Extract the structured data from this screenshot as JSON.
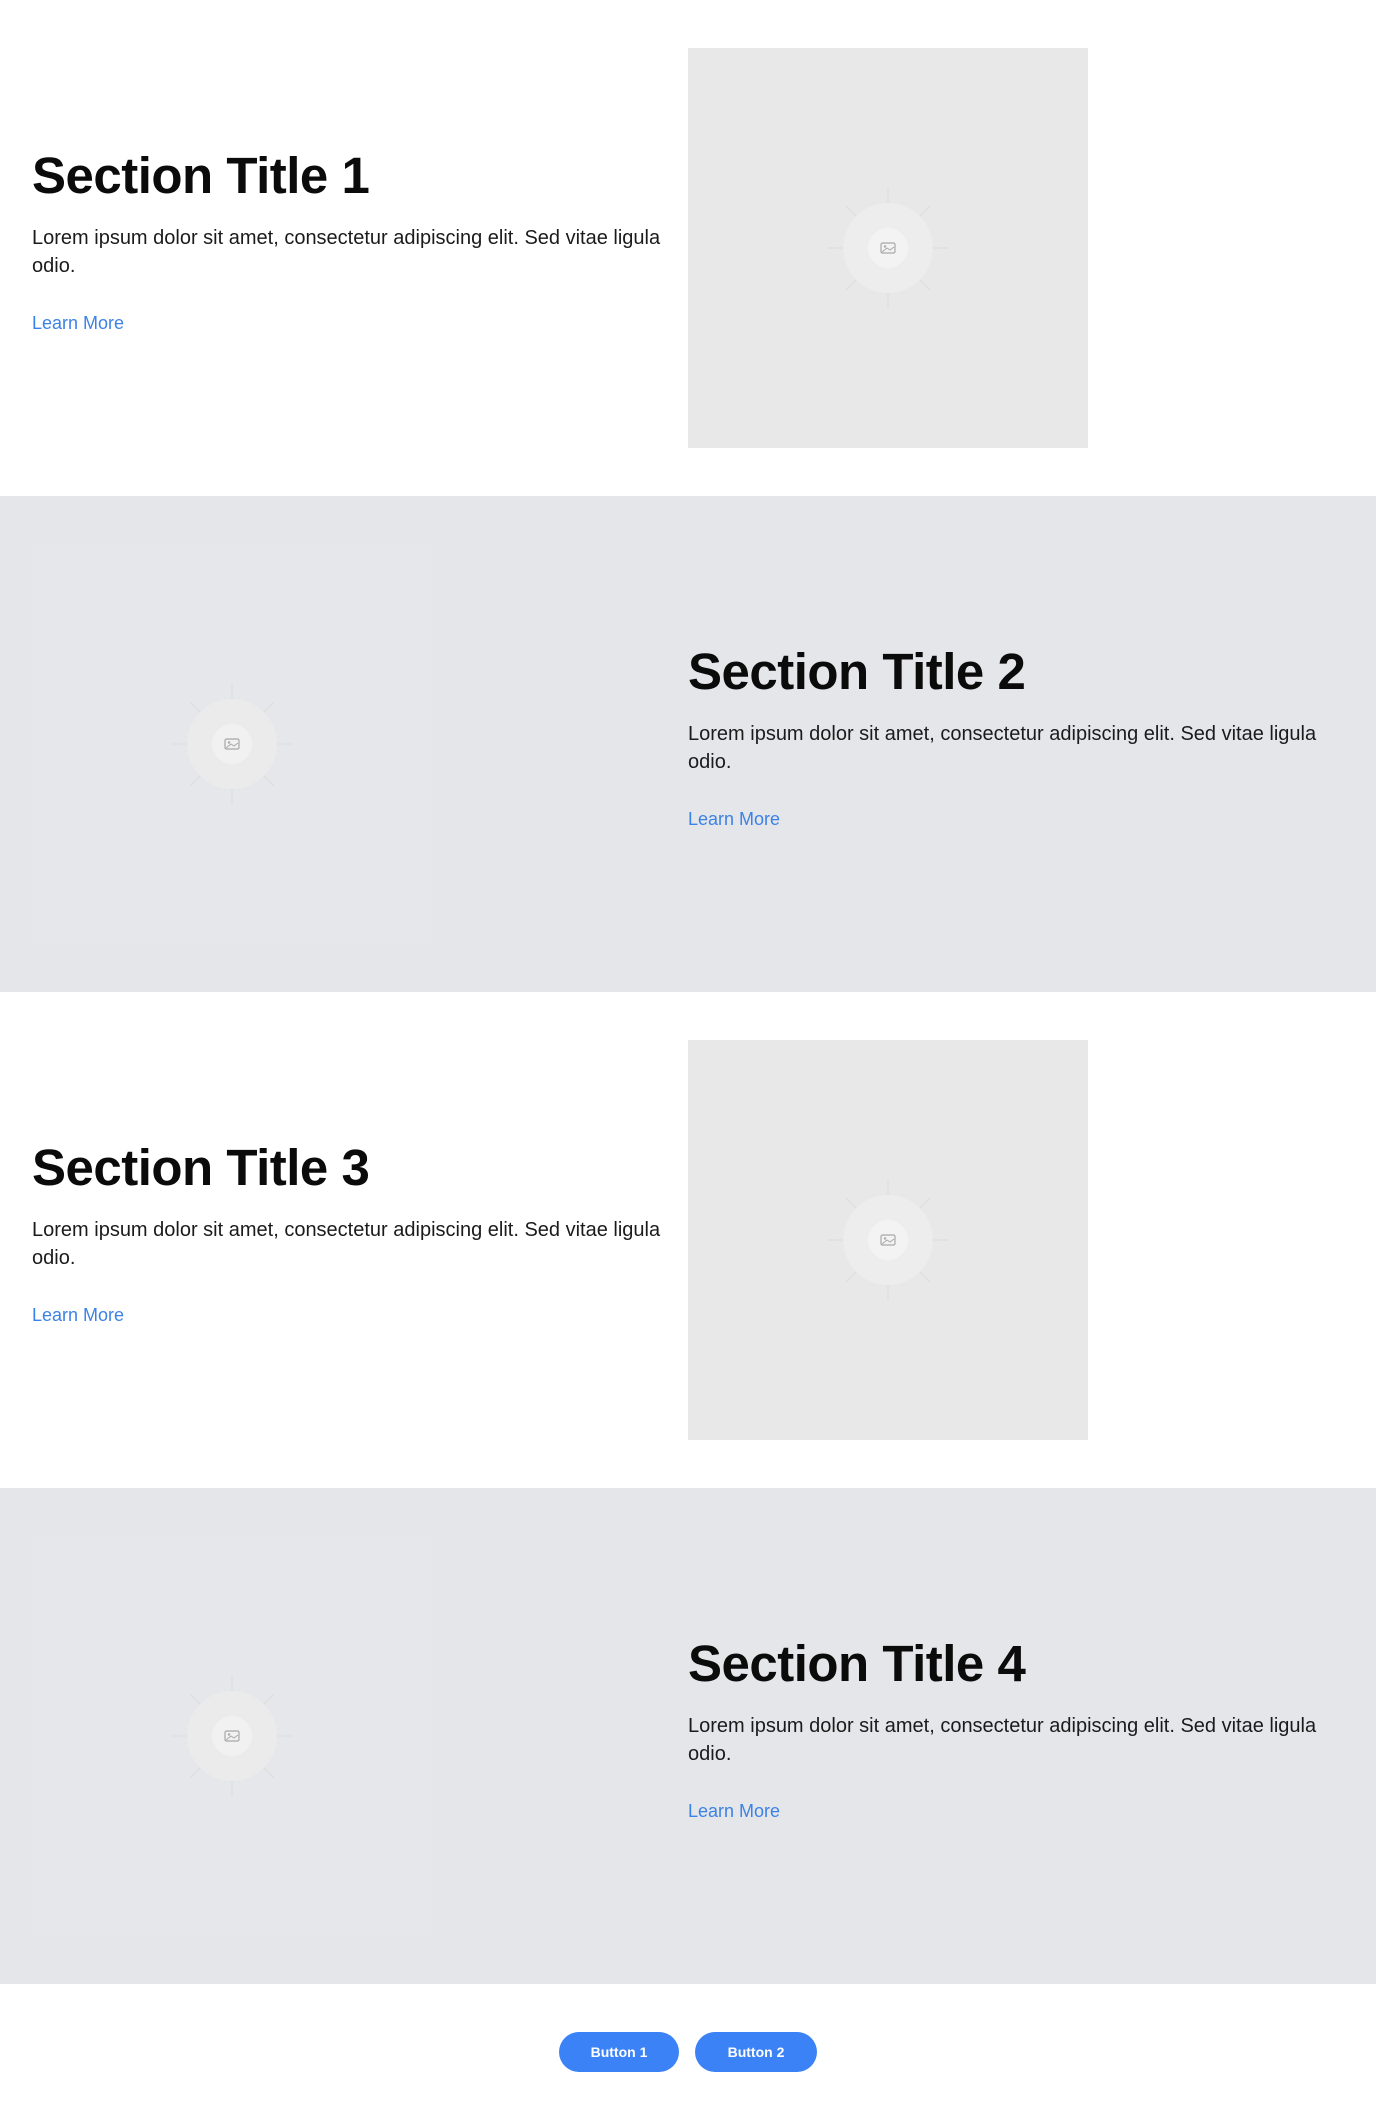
{
  "sections": [
    {
      "title": "Section Title 1",
      "body": "Lorem ipsum dolor sit amet, consectetur adipiscing elit. Sed vitae ligula odio.",
      "link": "Learn More",
      "image_icon": "image-icon"
    },
    {
      "title": "Section Title 2",
      "body": "Lorem ipsum dolor sit amet, consectetur adipiscing elit. Sed vitae ligula odio.",
      "link": "Learn More",
      "image_icon": "image-icon"
    },
    {
      "title": "Section Title 3",
      "body": "Lorem ipsum dolor sit amet, consectetur adipiscing elit. Sed vitae ligula odio.",
      "link": "Learn More",
      "image_icon": "image-icon"
    },
    {
      "title": "Section Title 4",
      "body": "Lorem ipsum dolor sit amet, consectetur adipiscing elit. Sed vitae ligula odio.",
      "link": "Learn More",
      "image_icon": "image-icon"
    }
  ],
  "footer": {
    "buttons": [
      "Button 1",
      "Button 2"
    ]
  },
  "colors": {
    "accent": "#3b82f6",
    "link": "#3b82e6",
    "alt_section_bg": "#e5e6ea",
    "image_placeholder_bg": "#e8e8e8"
  }
}
